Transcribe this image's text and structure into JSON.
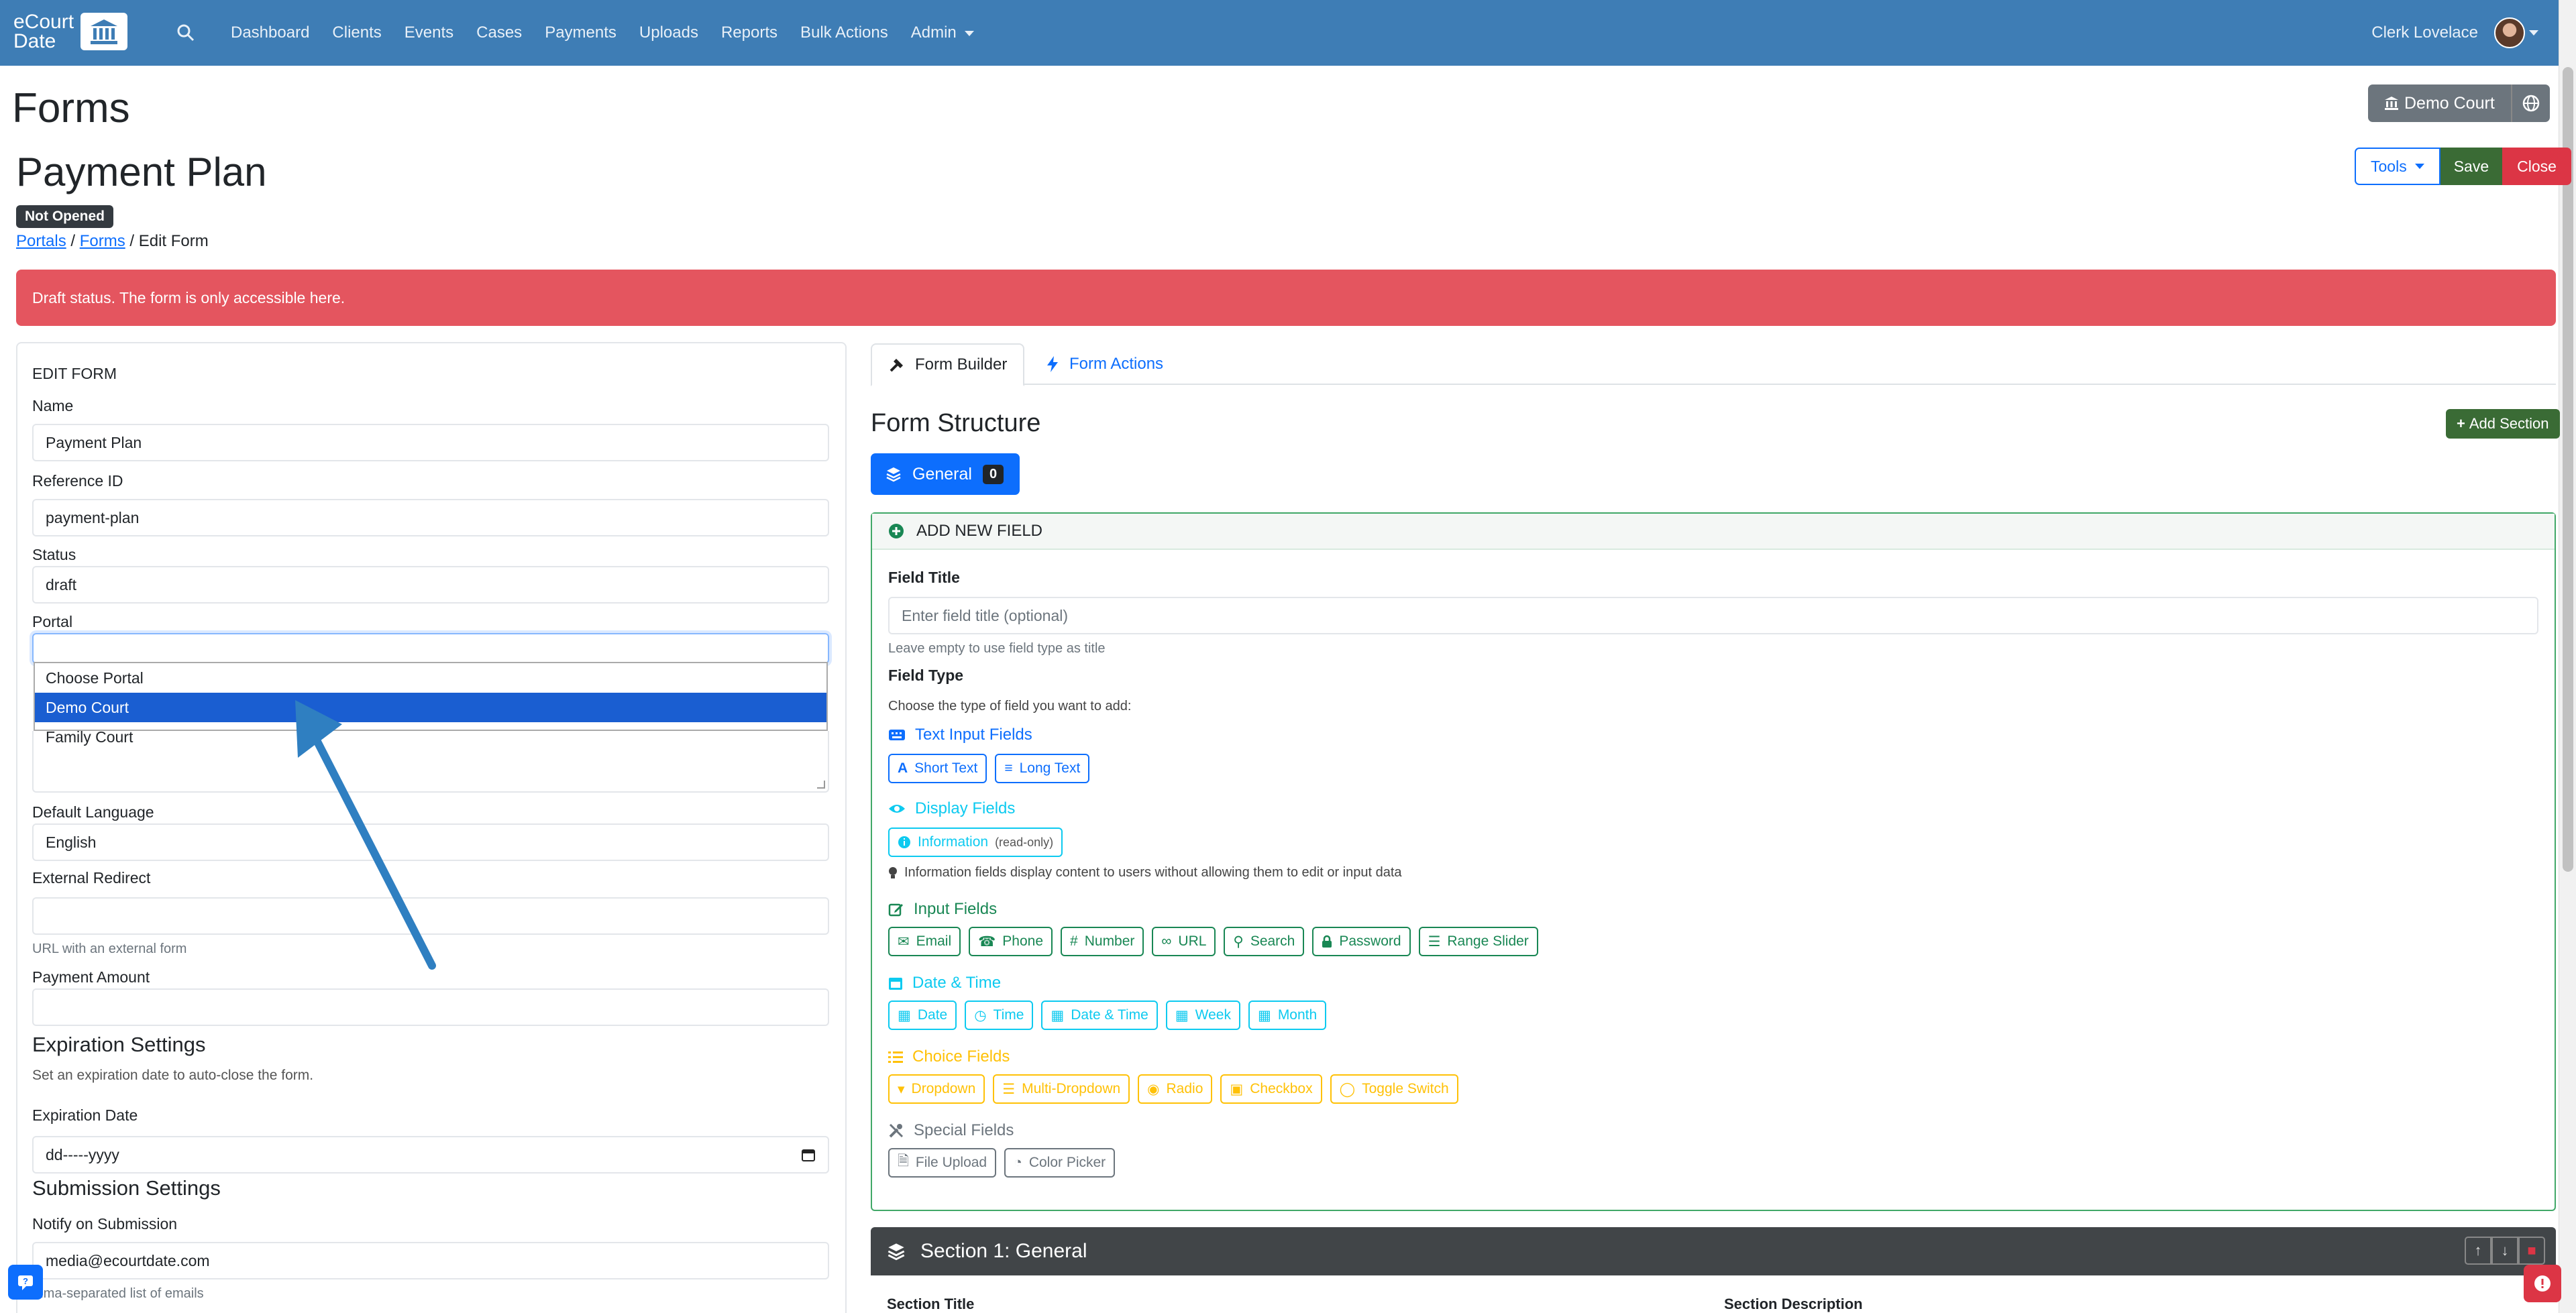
{
  "navbar": {
    "logo_line1": "eCourt",
    "logo_line2": "Date",
    "links": [
      "Dashboard",
      "Clients",
      "Events",
      "Cases",
      "Payments",
      "Uploads",
      "Reports",
      "Bulk Actions",
      "Admin"
    ],
    "user": "Clerk Lovelace"
  },
  "page": {
    "heading": "Forms",
    "form_title": "Payment Plan",
    "status_badge": "Not Opened",
    "breadcrumb": {
      "portals": "Portals",
      "sep1": " / ",
      "forms": "Forms",
      "sep2": " / ",
      "current": "Edit Form"
    },
    "court_button": "Demo Court",
    "tools": "Tools",
    "save": "Save",
    "close": "Close",
    "alert": "Draft status. The form is only accessible here."
  },
  "edit_form": {
    "header": "EDIT FORM",
    "name_label": "Name",
    "name_value": "Payment Plan",
    "ref_label": "Reference ID",
    "ref_value": "payment-plan",
    "status_label": "Status",
    "status_value": "draft",
    "portal_label": "Portal",
    "portal_options": [
      "Choose Portal",
      "Demo Court",
      "Family Court"
    ],
    "portal_selected": "Demo Court",
    "language_label": "Default Language",
    "language_value": "English",
    "redirect_label": "External Redirect",
    "redirect_value": "",
    "redirect_hint": "URL with an external form",
    "amount_label": "Payment Amount",
    "amount_value": "",
    "expiration_title": "Expiration Settings",
    "expiration_desc": "Set an expiration date to auto-close the form.",
    "expiration_label": "Expiration Date",
    "expiration_value": "dd-----yyyy",
    "submission_title": "Submission Settings",
    "notify_label": "Notify on Submission",
    "notify_value": "media@ecourtdate.com",
    "notify_hint": "mma-separated list of emails"
  },
  "builder": {
    "tabs": [
      "Form Builder",
      "Form Actions"
    ],
    "structure_title": "Form Structure",
    "add_section": "Add Section",
    "section_tab": "General",
    "section_count": "0",
    "add_new_field": "ADD NEW FIELD",
    "field_title_label": "Field Title",
    "field_title_placeholder": "Enter field title (optional)",
    "field_title_hint": "Leave empty to use field type as title",
    "field_type_label": "Field Type",
    "field_type_hint": "Choose the type of field you want to add:",
    "groups": {
      "text": {
        "title": "Text Input Fields",
        "buttons": [
          "Short Text",
          "Long Text"
        ]
      },
      "display": {
        "title": "Display Fields",
        "button": "Information",
        "button_note": "(read-only)",
        "note": "Information fields display content to users without allowing them to edit or input data"
      },
      "input": {
        "title": "Input Fields",
        "buttons": [
          "Email",
          "Phone",
          "Number",
          "URL",
          "Search",
          "Password",
          "Range Slider"
        ]
      },
      "datetime": {
        "title": "Date & Time",
        "buttons": [
          "Date",
          "Time",
          "Date & Time",
          "Week",
          "Month"
        ]
      },
      "choice": {
        "title": "Choice Fields",
        "buttons": [
          "Dropdown",
          "Multi-Dropdown",
          "Radio",
          "Checkbox",
          "Toggle Switch"
        ]
      },
      "special": {
        "title": "Special Fields",
        "buttons": [
          "File Upload",
          "Color Picker"
        ]
      }
    },
    "section_bar": "Section 1: General",
    "section_title_label": "Section Title",
    "section_desc_label": "Section Description"
  },
  "colors": {
    "navbar": "#3e7db5",
    "primary": "#0d6efd",
    "danger": "#dc3545",
    "success": "#3a6b35",
    "alert": "#e4555f"
  }
}
